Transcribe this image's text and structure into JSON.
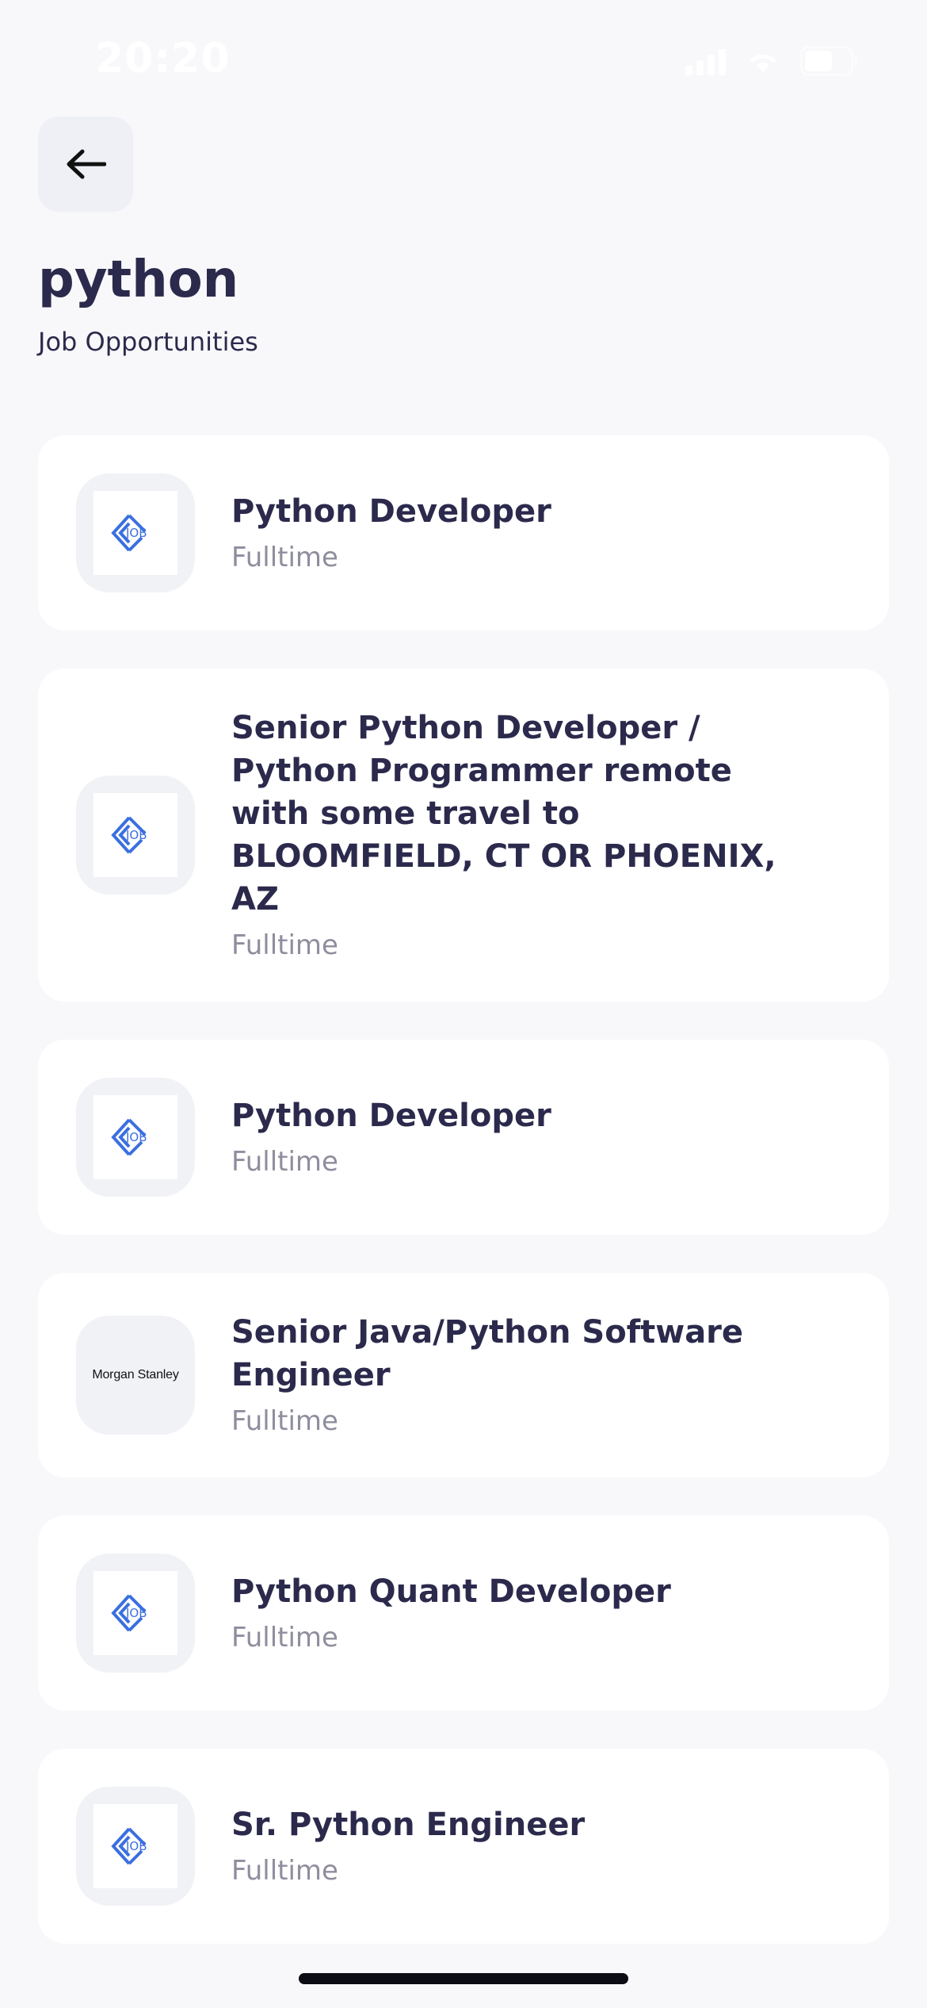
{
  "status_bar": {
    "time": "20:20",
    "battery": "54"
  },
  "header": {
    "back_icon": "arrow-left-icon",
    "title": "python",
    "subtitle": "Job Opportunities"
  },
  "jobs": [
    {
      "title": "Python Developer",
      "type": "Fulltime",
      "logo": "job-logo-icon"
    },
    {
      "title": "Senior Python Developer / Python Programmer remote with some travel to BLOOMFIELD, CT OR PHOENIX, AZ",
      "type": "Fulltime",
      "logo": "job-logo-icon"
    },
    {
      "title": "Python Developer",
      "type": "Fulltime",
      "logo": "job-logo-icon"
    },
    {
      "title": "Senior Java/Python Software Engineer",
      "type": "Fulltime",
      "logo_text": "Morgan Stanley"
    },
    {
      "title": "Python Quant Developer",
      "type": "Fulltime",
      "logo": "job-logo-icon"
    },
    {
      "title": "Sr. Python Engineer",
      "type": "Fulltime",
      "logo": "job-logo-icon"
    }
  ],
  "colors": {
    "background": "#f8f8fb",
    "title": "#2b2a4c",
    "muted": "#8e8e9e",
    "logo_blue": "#3b6fe0"
  }
}
